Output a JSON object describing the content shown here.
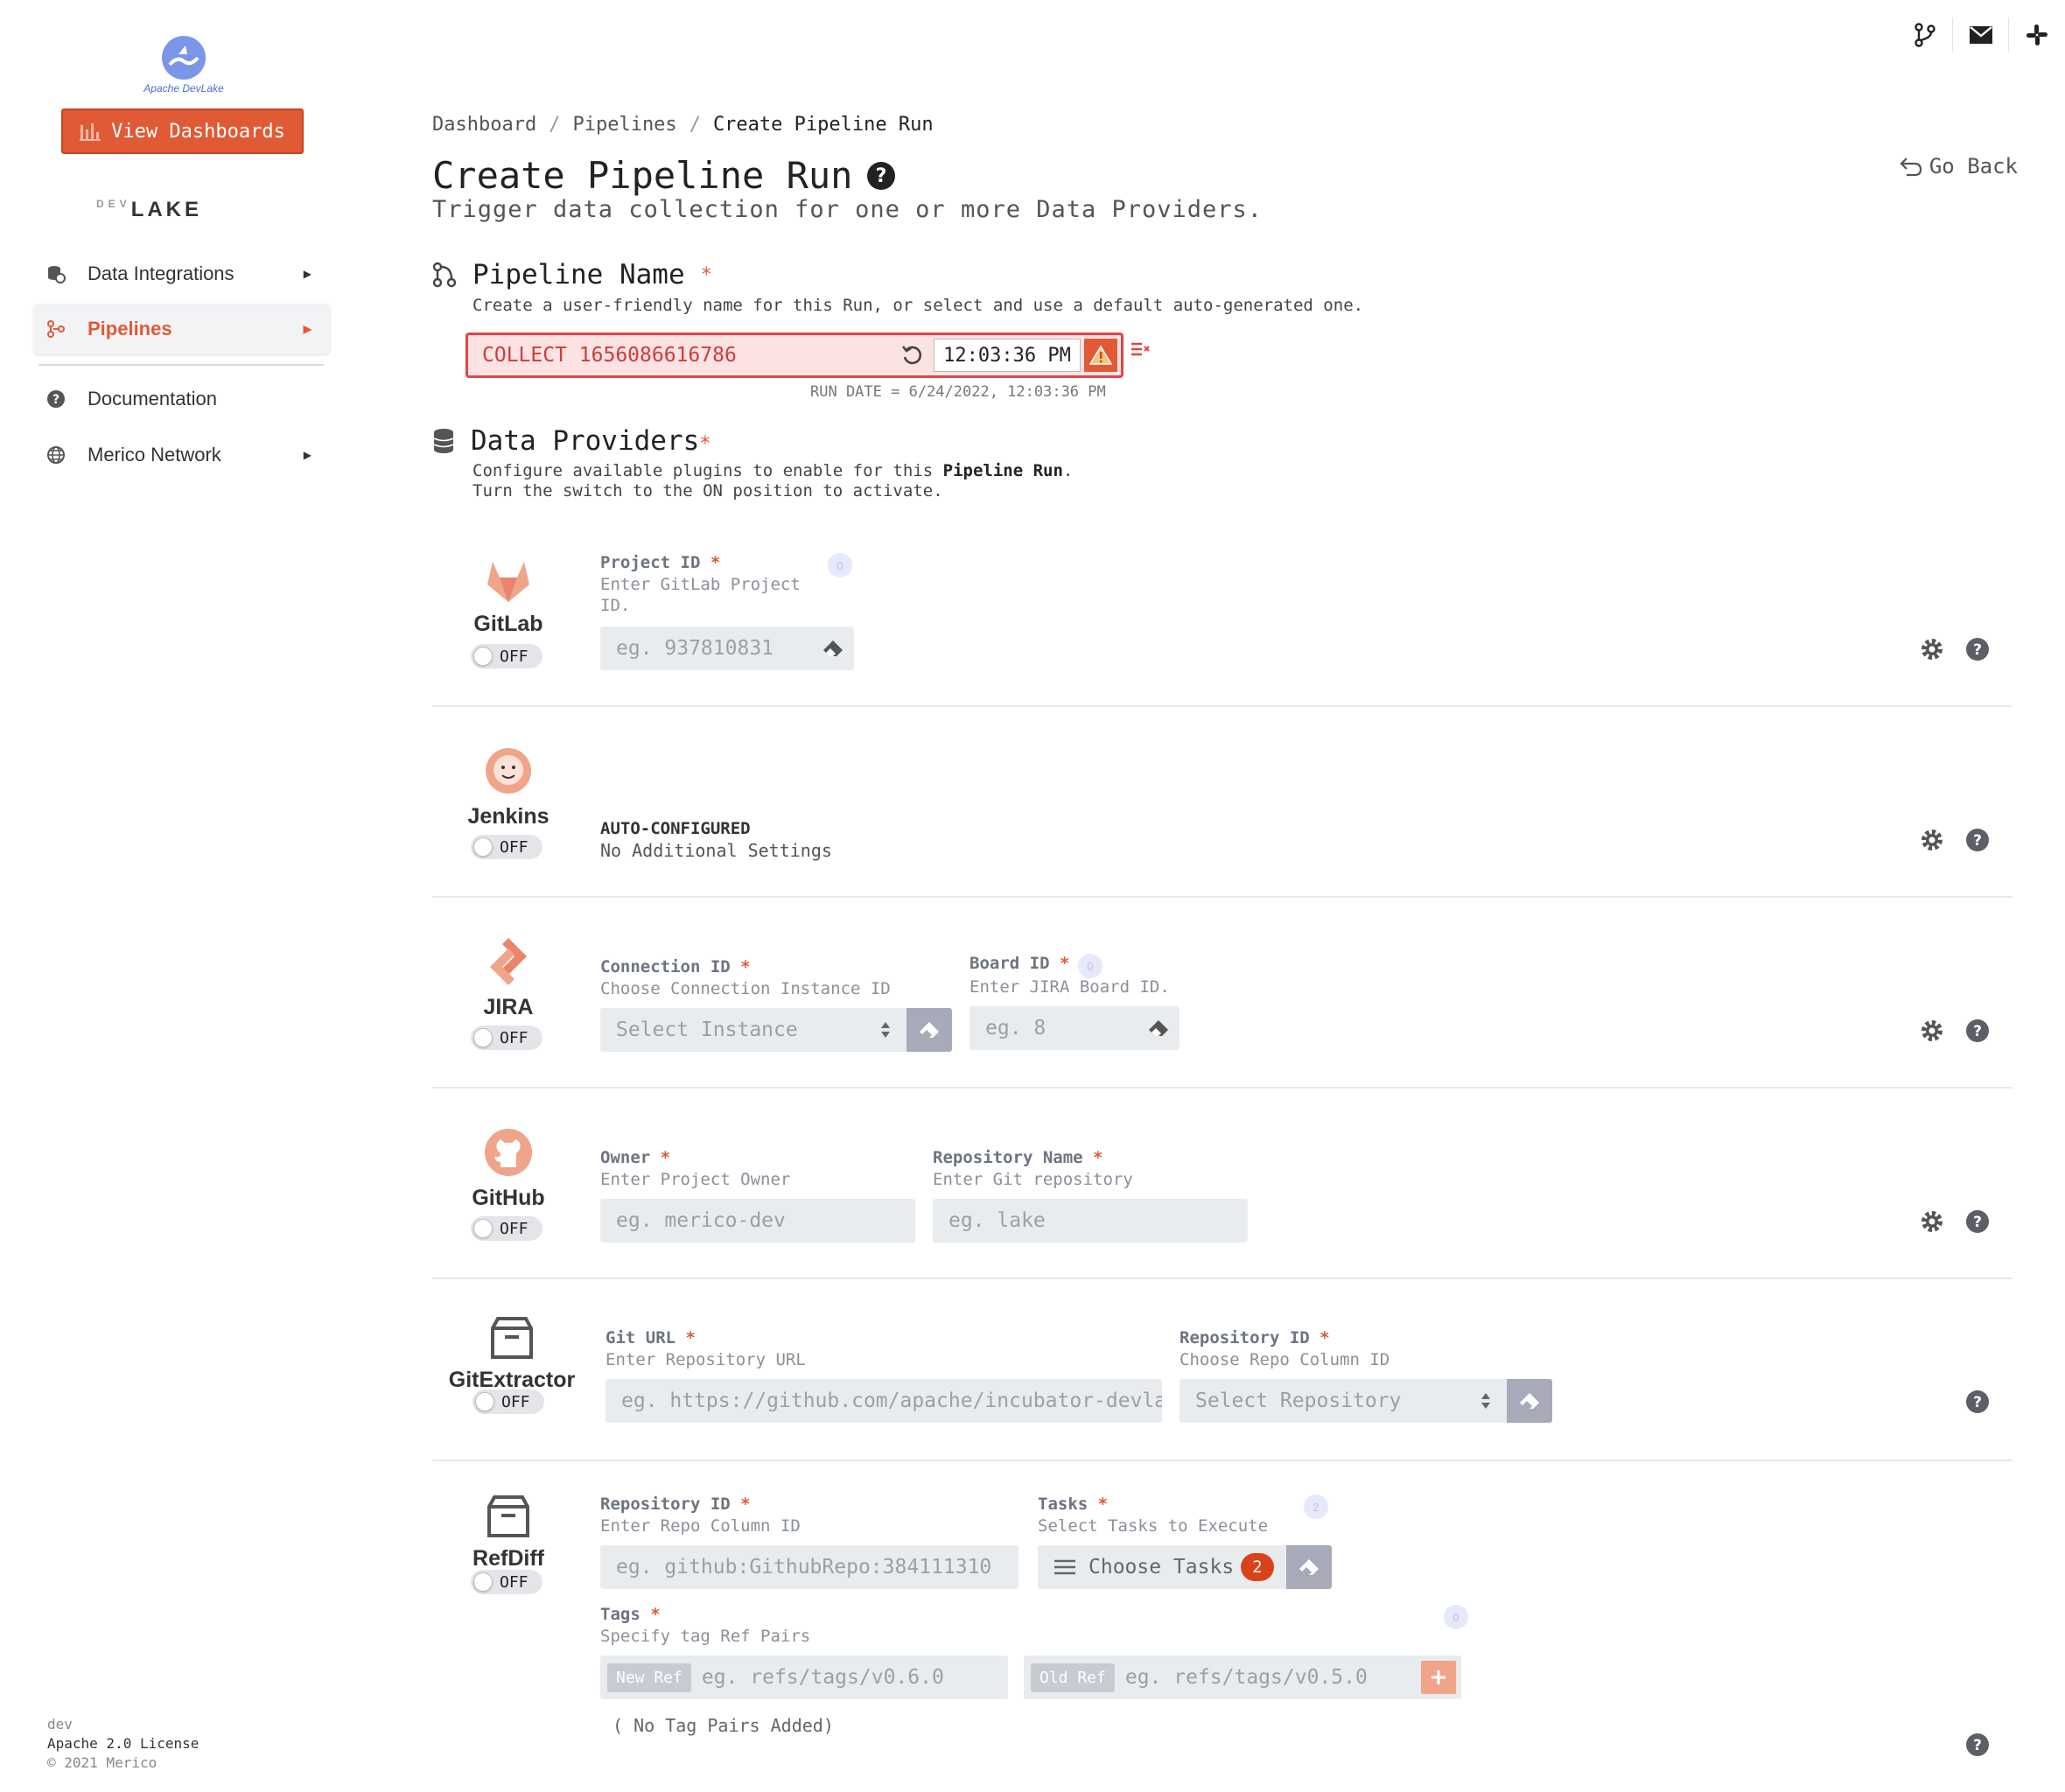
{
  "sidebar": {
    "logo_text": "Apache DevLake",
    "view_dashboards_label": "View Dashboards",
    "brand_small": "DEV",
    "brand_big": "LAKE",
    "items": [
      {
        "label": "Data Integrations"
      },
      {
        "label": "Pipelines"
      },
      {
        "label": "Documentation"
      },
      {
        "label": "Merico Network"
      }
    ],
    "footer": {
      "env": "dev",
      "license": "Apache 2.0 License",
      "copyright": "© 2021 Merico"
    }
  },
  "topbar": {
    "icons": [
      "git-branch-icon",
      "mail-icon",
      "slack-icon"
    ]
  },
  "breadcrumb": {
    "items": [
      "Dashboard",
      "Pipelines",
      "Create Pipeline Run"
    ],
    "separator": "/"
  },
  "page": {
    "title": "Create Pipeline Run",
    "subtitle": "Trigger data collection for one or more Data Providers.",
    "go_back": "Go Back"
  },
  "pipeline_name": {
    "heading": "Pipeline Name",
    "required_mark": "*",
    "description": "Create a user-friendly name for this Run, or select and use a default auto-generated one.",
    "value": "COLLECT 1656086616786",
    "time": "12:03:36 PM",
    "run_date": "RUN DATE = 6/24/2022, 12:03:36 PM"
  },
  "data_providers": {
    "heading": "Data Providers",
    "required_mark": "*",
    "desc_line1_pre": "Configure available plugins to enable for this ",
    "desc_line1_bold": "Pipeline Run",
    "desc_line1_post": ".",
    "desc_line2": "Turn the switch to the ON position to activate."
  },
  "providers": {
    "gitlab": {
      "name": "GitLab",
      "toggle": "OFF",
      "project_label": "Project ID",
      "project_hint": "Enter GitLab Project ID.",
      "project_placeholder": "eg. 937810831",
      "info": "0"
    },
    "jenkins": {
      "name": "Jenkins",
      "toggle": "OFF",
      "auto_title": "AUTO-CONFIGURED",
      "auto_text": "No Additional Settings"
    },
    "jira": {
      "name": "JIRA",
      "toggle": "OFF",
      "connection_label": "Connection ID",
      "connection_hint": "Choose Connection Instance ID",
      "connection_placeholder": "Select Instance",
      "board_label": "Board ID",
      "board_hint": "Enter JIRA Board ID.",
      "board_placeholder": "eg. 8",
      "info": "0"
    },
    "github": {
      "name": "GitHub",
      "toggle": "OFF",
      "owner_label": "Owner",
      "owner_hint": "Enter Project Owner",
      "owner_placeholder": "eg. merico-dev",
      "repo_label": "Repository Name",
      "repo_hint": "Enter Git repository",
      "repo_placeholder": "eg. lake"
    },
    "gitextractor": {
      "name": "GitExtractor",
      "toggle": "OFF",
      "url_label": "Git URL",
      "url_hint": "Enter Repository URL",
      "url_placeholder": "eg. https://github.com/apache/incubator-devlake.git",
      "repoid_label": "Repository ID",
      "repoid_hint": "Choose Repo Column ID",
      "repoid_placeholder": "Select Repository"
    },
    "refdiff": {
      "name": "RefDiff",
      "toggle": "OFF",
      "repoid_label": "Repository ID",
      "repoid_hint": "Enter Repo Column ID",
      "repoid_placeholder": "eg. github:GithubRepo:384111310",
      "tasks_label": "Tasks",
      "tasks_hint": "Select Tasks to Execute",
      "tasks_button": "Choose Tasks",
      "tasks_count": "2",
      "tasks_info": "2",
      "tags_label": "Tags",
      "tags_hint": "Specify tag Ref Pairs",
      "tags_info": "0",
      "new_ref_tag": "New Ref",
      "new_ref_placeholder": "eg. refs/tags/v0.6.0",
      "old_ref_tag": "Old Ref",
      "old_ref_placeholder": "eg. refs/tags/v0.5.0",
      "no_tags": "( No Tag Pairs Added)"
    }
  },
  "colors": {
    "accent": "#e05a35",
    "error": "#e04646",
    "input_bg": "#e9ecef"
  }
}
